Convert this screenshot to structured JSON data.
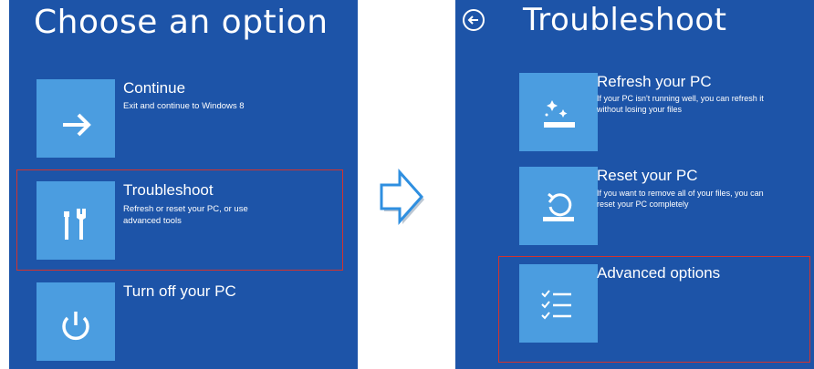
{
  "left": {
    "title": "Choose an option",
    "options": [
      {
        "title": "Continue",
        "desc": "Exit and continue to Windows 8",
        "icon": "arrow-right-icon"
      },
      {
        "title": "Troubleshoot",
        "desc": "Refresh or reset your PC, or use advanced tools",
        "icon": "tools-icon"
      },
      {
        "title": "Turn off your PC",
        "desc": "",
        "icon": "power-icon"
      }
    ]
  },
  "right": {
    "title": "Troubleshoot",
    "back_icon": "back-arrow-icon",
    "options": [
      {
        "title": "Refresh your PC",
        "desc": "If your PC isn't running well, you can refresh it without losing your files",
        "icon": "refresh-pc-icon"
      },
      {
        "title": "Reset your PC",
        "desc": "If you want to remove all of your files, you can reset your PC completely",
        "icon": "reset-pc-icon"
      },
      {
        "title": "Advanced options",
        "desc": "",
        "icon": "checklist-icon"
      }
    ]
  },
  "colors": {
    "background": "#1d54a8",
    "tile": "#4b9de0",
    "highlight": "#d2332e",
    "arrow": "#2f8fe0"
  }
}
